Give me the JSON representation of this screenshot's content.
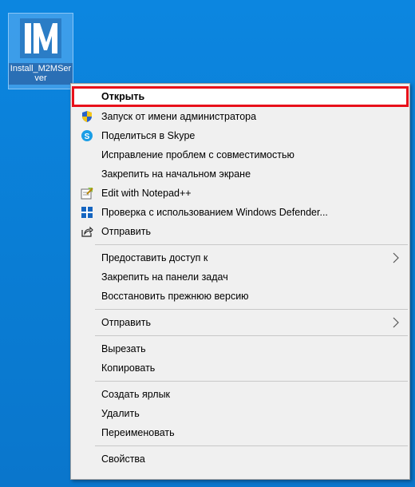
{
  "desktop_icon": {
    "label": "Install_M2MServer"
  },
  "context_menu": {
    "items": [
      {
        "label": "Открыть",
        "icon": "",
        "default": true
      },
      {
        "label": "Запуск от имени администратора",
        "icon": "uac-shield-icon"
      },
      {
        "label": "Поделиться в Skype",
        "icon": "skype-icon"
      },
      {
        "label": "Исправление проблем с совместимостью",
        "icon": ""
      },
      {
        "label": "Закрепить на начальном экране",
        "icon": ""
      },
      {
        "label": "Edit with Notepad++",
        "icon": "notepad-plus-plus-icon"
      },
      {
        "label": "Проверка с использованием Windows Defender...",
        "icon": "windows-defender-icon"
      },
      {
        "label": "Отправить",
        "icon": "share-icon"
      },
      {
        "label": "Предоставить доступ к",
        "icon": "",
        "submenu": true
      },
      {
        "label": "Закрепить на панели задач",
        "icon": ""
      },
      {
        "label": "Восстановить прежнюю версию",
        "icon": ""
      },
      {
        "label": "Отправить",
        "icon": "",
        "submenu": true
      },
      {
        "label": "Вырезать",
        "icon": ""
      },
      {
        "label": "Копировать",
        "icon": ""
      },
      {
        "label": "Создать ярлык",
        "icon": ""
      },
      {
        "label": "Удалить",
        "icon": ""
      },
      {
        "label": "Переименовать",
        "icon": ""
      },
      {
        "label": "Свойства",
        "icon": ""
      }
    ]
  },
  "colors": {
    "desktop_background": "#0a7fd6",
    "highlight_border": "#e8101a",
    "menu_background": "#f0f0f0"
  }
}
